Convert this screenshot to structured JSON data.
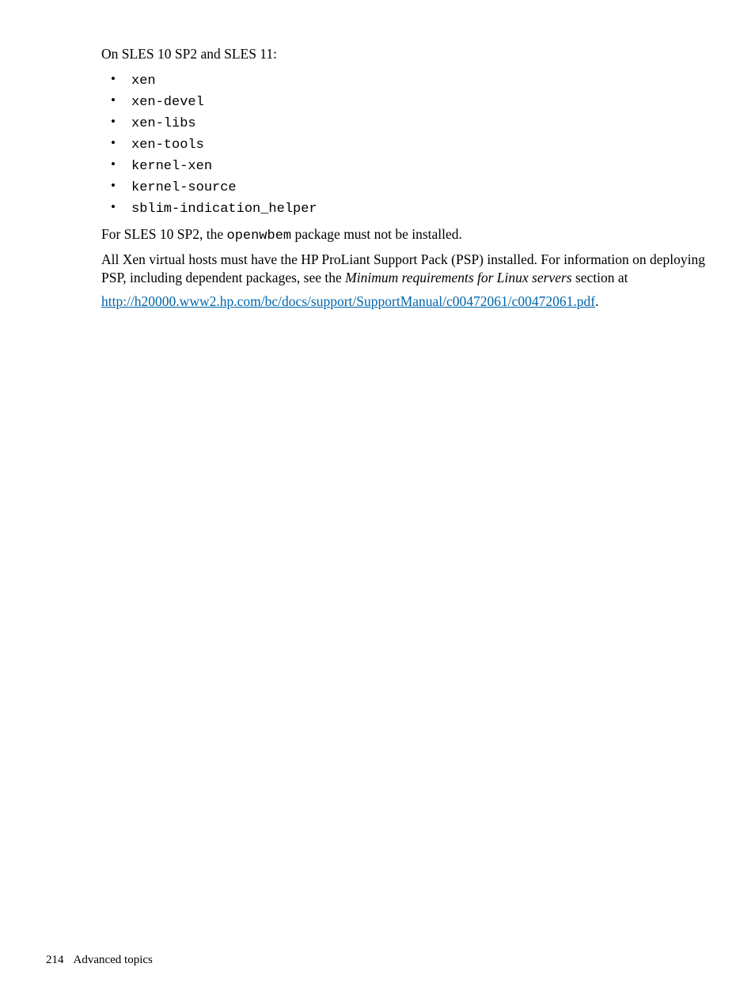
{
  "intro": "On SLES 10 SP2 and SLES 11:",
  "packages": [
    "xen",
    "xen-devel",
    "xen-libs",
    "xen-tools",
    "kernel-xen",
    "kernel-source",
    "sblim-indication_helper"
  ],
  "para1_pre": "For SLES 10 SP2, the ",
  "para1_mono": "openwbem",
  "para1_post": " package must not be installed.",
  "para2_pre": "All Xen virtual hosts must have the HP ProLiant Support Pack (PSP) installed. For information on deploying PSP, including dependent packages, see the ",
  "para2_italic": "Minimum requirements for Linux servers",
  "para2_post": " section at",
  "link_text": "http://h20000.www2.hp.com/bc/docs/support/SupportManual/c00472061/c00472061.pdf",
  "link_period": ".",
  "footer": {
    "page": "214",
    "section": "Advanced topics"
  }
}
